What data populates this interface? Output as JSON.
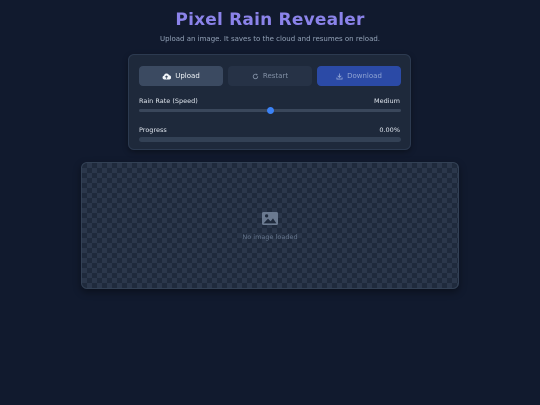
{
  "header": {
    "title": "Pixel Rain Revealer",
    "subtitle": "Upload an image. It saves to the cloud and resumes on reload."
  },
  "toolbar": {
    "upload_label": "Upload",
    "upload_icon": "cloud-upload-icon",
    "restart_label": "Restart",
    "restart_icon": "restart-icon",
    "download_label": "Download",
    "download_icon": "download-icon"
  },
  "rain_rate": {
    "label": "Rain Rate (Speed)",
    "value_label": "Medium",
    "level": 0.5
  },
  "progress": {
    "label": "Progress",
    "value_label": "0.00%",
    "fraction": 0
  },
  "canvas": {
    "empty_text": "No image loaded",
    "empty_icon": "image-icon"
  },
  "colors": {
    "background": "#111a2e",
    "title": "#8b83ea",
    "accent": "#3b82f6",
    "download_button": "#2b4aa6"
  }
}
